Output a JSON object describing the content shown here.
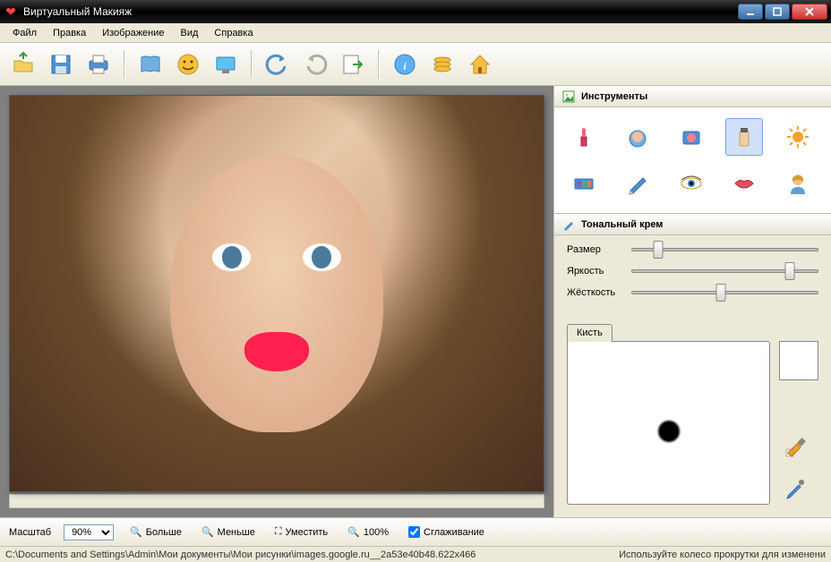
{
  "window": {
    "title": "Виртуальный Макияж"
  },
  "menu": [
    "Файл",
    "Правка",
    "Изображение",
    "Вид",
    "Справка"
  ],
  "toolbar_icons": [
    "open",
    "save",
    "print",
    "book",
    "smile",
    "screen",
    "undo",
    "redo",
    "export",
    "info",
    "coins",
    "home"
  ],
  "panels": {
    "tools": {
      "title": "Инструменты"
    },
    "current": {
      "title": "Тональный крем"
    }
  },
  "tool_grid": [
    {
      "name": "lipstick-icon",
      "active": false
    },
    {
      "name": "powder-icon",
      "active": false
    },
    {
      "name": "blush-icon",
      "active": false
    },
    {
      "name": "foundation-icon",
      "active": true
    },
    {
      "name": "sun-icon",
      "active": false
    },
    {
      "name": "eyeshadow-icon",
      "active": false
    },
    {
      "name": "pencil-icon",
      "active": false
    },
    {
      "name": "eye-icon",
      "active": false
    },
    {
      "name": "lips-icon",
      "active": false
    },
    {
      "name": "person-icon",
      "active": false
    }
  ],
  "sliders": {
    "size": {
      "label": "Размер",
      "value": 14
    },
    "brightness": {
      "label": "Яркость",
      "value": 85
    },
    "hardness": {
      "label": "Жёсткость",
      "value": 48
    }
  },
  "brush": {
    "tab": "Кисть"
  },
  "bottombar": {
    "zoom_label": "Масштаб",
    "zoom_value": "90%",
    "bigger": "Больше",
    "smaller": "Меньше",
    "fit": "Уместить",
    "hundred": "100%",
    "smoothing": "Сглаживание",
    "smoothing_checked": true
  },
  "statusbar": {
    "path": "C:\\Documents and Settings\\Admin\\Мои документы\\Мои рисунки\\images.google.ru__2a53e40b48.622x466",
    "hint": "Используйте колесо прокрутки для изменени"
  }
}
